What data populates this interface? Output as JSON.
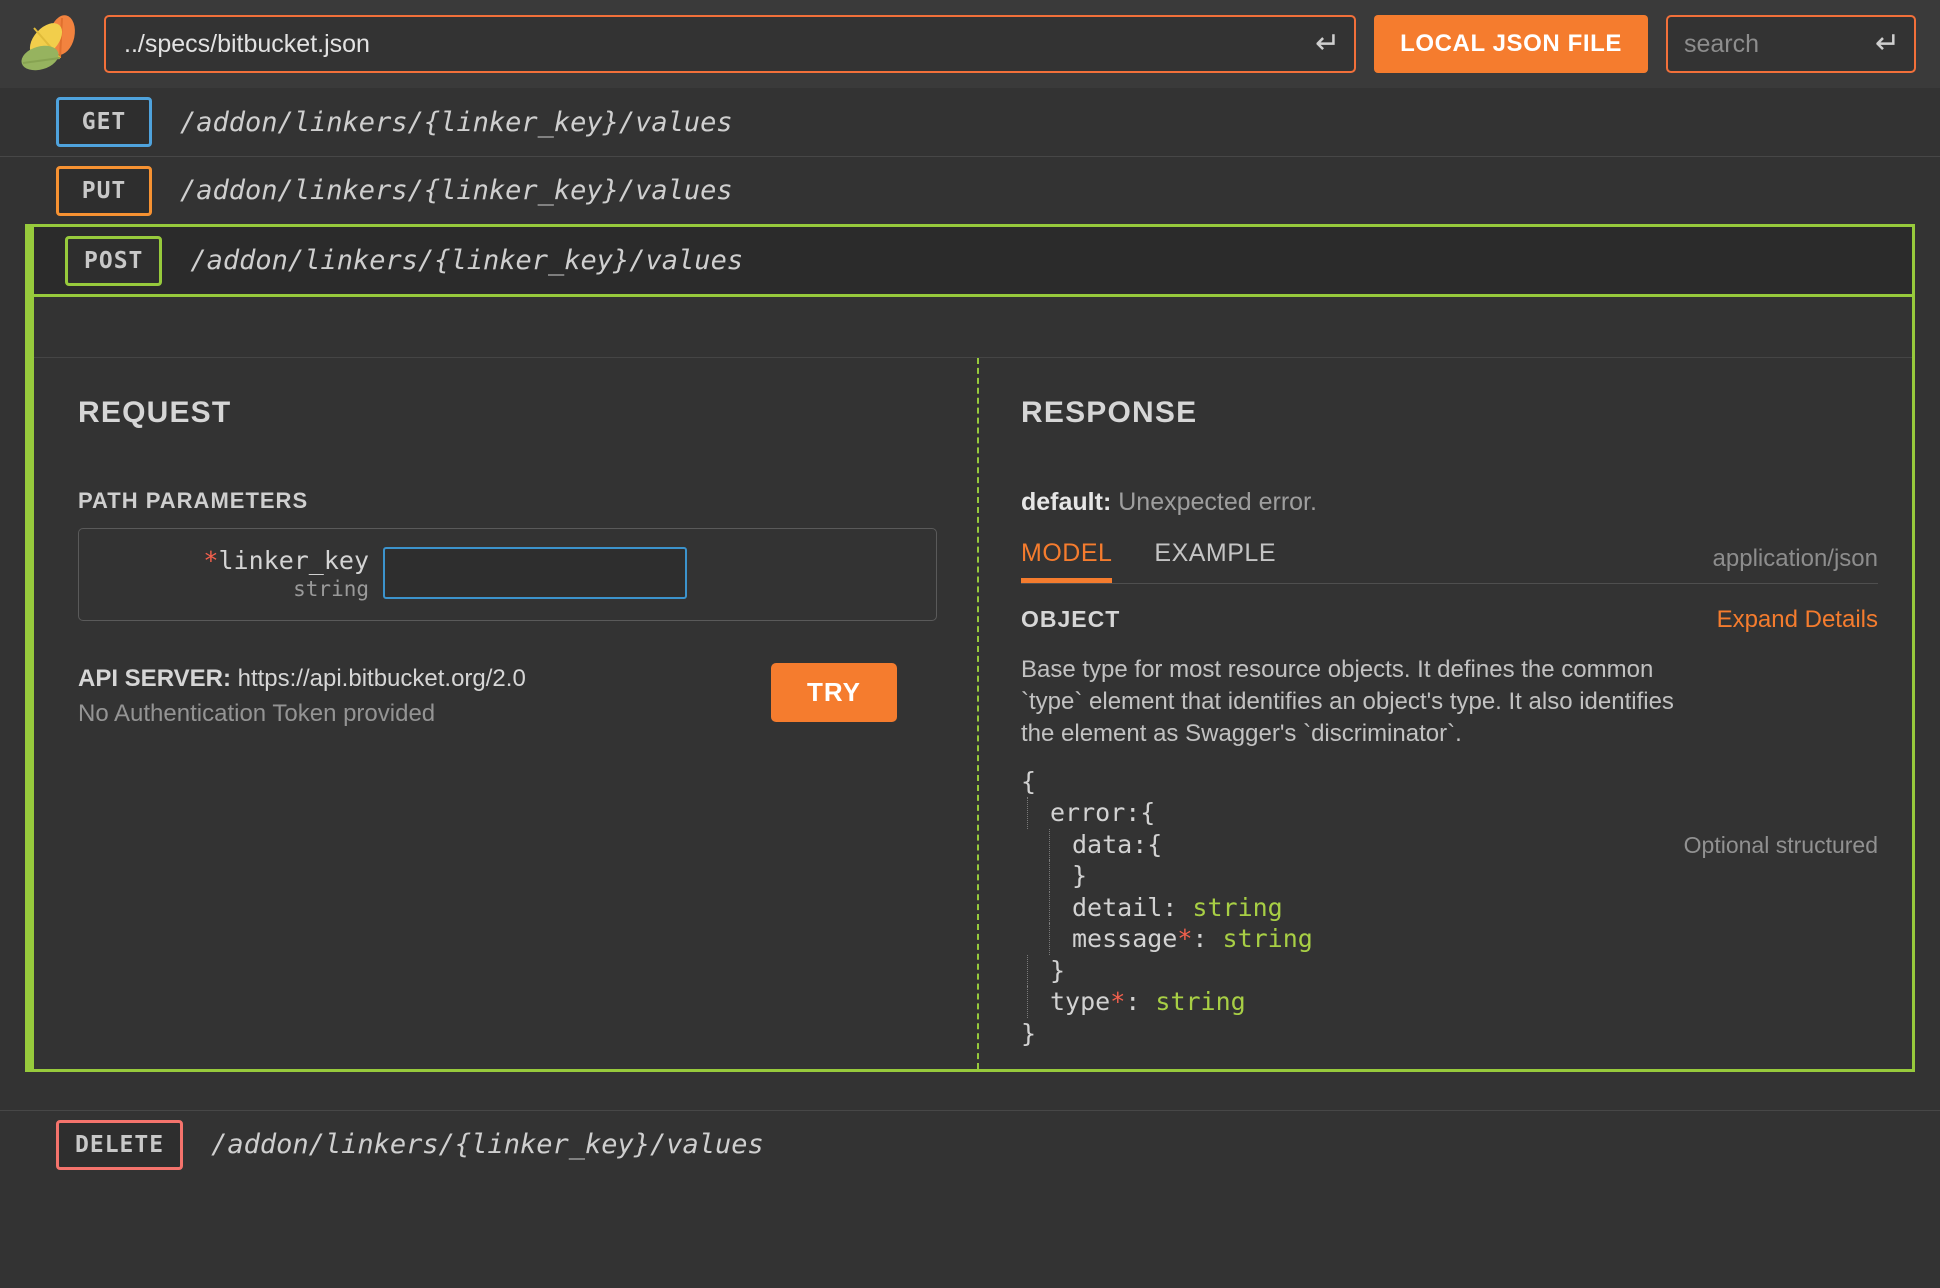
{
  "topbar": {
    "logo_name": "leaf-logo",
    "url_value": "../specs/bitbucket.json",
    "url_placeholder": "",
    "url_enter_icon": "enter-return-icon",
    "local_json_button": "LOCAL JSON FILE",
    "search_value": "",
    "search_placeholder": "search",
    "search_enter_icon": "enter-return-icon"
  },
  "operations": [
    {
      "verb": "GET",
      "verb_class": "get",
      "path": "/addon/linkers/{linker_key}/values",
      "expanded": false
    },
    {
      "verb": "PUT",
      "verb_class": "put",
      "path": "/addon/linkers/{linker_key}/values",
      "expanded": false
    },
    {
      "verb": "POST",
      "verb_class": "post",
      "path": "/addon/linkers/{linker_key}/values",
      "expanded": true
    },
    {
      "verb": "DELETE",
      "verb_class": "delete",
      "path": "/addon/linkers/{linker_key}/values",
      "expanded": false
    }
  ],
  "expanded_panel": {
    "verb": "POST",
    "path": "/addon/linkers/{linker_key}/values",
    "request": {
      "title": "REQUEST",
      "path_parameters_title": "PATH PARAMETERS",
      "parameters": [
        {
          "required_marker": "*",
          "name": "linker_key",
          "type": "string",
          "value": "",
          "placeholder": ""
        }
      ],
      "api_server_label": "API SERVER:",
      "api_server_url": "https://api.bitbucket.org/2.0",
      "auth_note": "No Authentication Token provided",
      "try_button": "TRY"
    },
    "response": {
      "title": "RESPONSE",
      "status_code": "default:",
      "status_text": "Unexpected error.",
      "tabs": [
        {
          "label": "MODEL",
          "active": true
        },
        {
          "label": "EXAMPLE",
          "active": false
        }
      ],
      "mime_type": "application/json",
      "object_label": "OBJECT",
      "expand_details": "Expand Details",
      "object_description": "Base type for most resource objects. It defines the common `type` element that identifies an object's type. It also identifies the element as Swagger's `discriminator`.",
      "model_tree": [
        {
          "depth": 0,
          "text": "{",
          "note": ""
        },
        {
          "depth": 1,
          "text": "error:{",
          "note": ""
        },
        {
          "depth": 2,
          "text": "data:{",
          "note": "Optional structured"
        },
        {
          "depth": 2,
          "text": "}",
          "note": ""
        },
        {
          "depth": 2,
          "text": "detail: ",
          "type": "string",
          "note": ""
        },
        {
          "depth": 2,
          "text": "message",
          "required": "*",
          "sep": ": ",
          "type": "string",
          "note": ""
        },
        {
          "depth": 1,
          "text": "}",
          "note": ""
        },
        {
          "depth": 1,
          "text": "type",
          "required": "*",
          "sep": ": ",
          "type": "string",
          "note": ""
        },
        {
          "depth": 0,
          "text": "}",
          "note": ""
        }
      ]
    }
  },
  "colors": {
    "accent_orange": "#f57c2e",
    "get_blue": "#4fa3dd",
    "put_orange": "#f79232",
    "post_green": "#97ca3c",
    "delete_red": "#f4736c",
    "string_green": "#a8cf45",
    "required_red": "#f4604d",
    "page_bg": "#333333",
    "topbar_bg": "#3a3a3a"
  }
}
